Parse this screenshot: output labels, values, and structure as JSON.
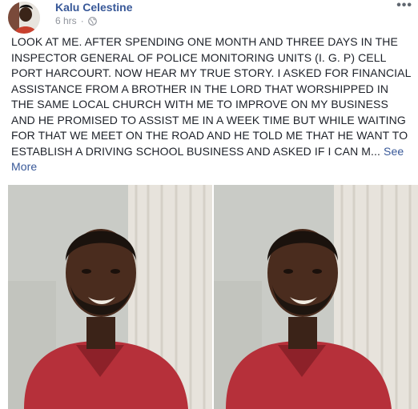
{
  "post": {
    "author": "Kalu Celestine",
    "time": "6 hrs",
    "separator": "·",
    "privacy_icon": "globe-icon",
    "options_icon": "more-options-icon",
    "options_glyph": "•••",
    "text": "LOOK AT ME. AFTER SPENDING ONE MONTH AND THREE DAYS IN THE INSPECTOR GENERAL OF POLICE MONITORING UNITS (I. G. P) CELL PORT HARCOURT. NOW HEAR MY TRUE STORY. I ASKED FOR FINANCIAL ASSISTANCE FROM A BROTHER IN THE LORD THAT WORSHIPPED IN THE SAME LOCAL CHURCH WITH ME TO IMPROVE ON MY BUSINESS AND HE PROMISED TO ASSIST ME IN A WEEK TIME BUT WHILE WAITING FOR THAT WE MEET ON THE ROAD AND HE TOLD ME THAT HE WANT TO ESTABLISH A DRIVING SCHOOL BUSINESS AND ASKED IF I CAN M...",
    "see_more": "See More"
  },
  "colors": {
    "author": "#385898",
    "meta": "#90949c",
    "shirt": "#b6303a",
    "wall": "#c9cbc6",
    "curtain": "#e7e3dc"
  }
}
